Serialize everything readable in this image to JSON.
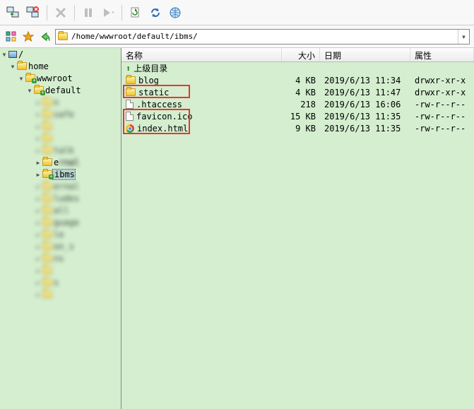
{
  "address_path": "/home/wwwroot/default/ibms/",
  "tree": {
    "root": "/",
    "nodes": [
      "home",
      "wwwroot",
      "default"
    ],
    "selected": "ibms",
    "blurred_siblings": [
      "n",
      "safe",
      "",
      "",
      "talk",
      "re",
      "ernal",
      "ludes",
      "all",
      "guage",
      "le",
      "on_s",
      "ns",
      "",
      "s",
      ""
    ]
  },
  "columns": {
    "name": "名称",
    "size": "大小",
    "date": "日期",
    "attr": "属性"
  },
  "up_dir_label": "上级目录",
  "files": [
    {
      "icon": "folder",
      "name": "blog",
      "size": "4 KB",
      "date": "2019/6/13 11:34",
      "attr": "drwxr-xr-x"
    },
    {
      "icon": "folder",
      "name": "static",
      "size": "4 KB",
      "date": "2019/6/13 11:47",
      "attr": "drwxr-xr-x",
      "highlight": true
    },
    {
      "icon": "file",
      "name": ".htaccess",
      "size": "218",
      "date": "2019/6/13 16:06",
      "attr": "-rw-r--r--"
    },
    {
      "icon": "file",
      "name": "favicon.ico",
      "size": "15 KB",
      "date": "2019/6/13 11:35",
      "attr": "-rw-r--r--",
      "highlight": true
    },
    {
      "icon": "chrome",
      "name": "index.html",
      "size": "9 KB",
      "date": "2019/6/13 11:35",
      "attr": "-rw-r--r--",
      "highlight": true
    }
  ]
}
